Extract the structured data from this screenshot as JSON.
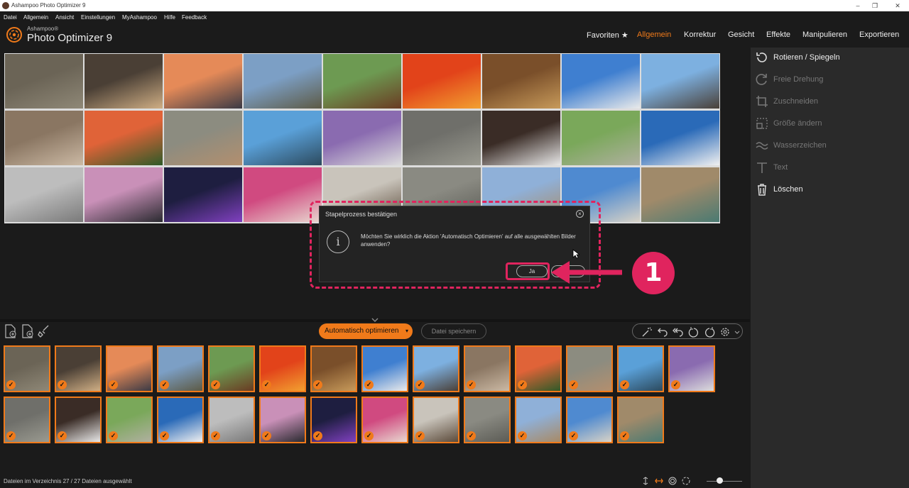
{
  "window": {
    "title": "Ashampoo Photo Optimizer 9"
  },
  "menu": [
    "Datei",
    "Allgemein",
    "Ansicht",
    "Einstellungen",
    "MyAshampoo",
    "Hilfe",
    "Feedback"
  ],
  "logo": {
    "brand": "Ashampoo®",
    "product": "Photo Optimizer 9"
  },
  "nav": {
    "items": [
      "Favoriten ★",
      "Allgemein",
      "Korrektur",
      "Gesicht",
      "Effekte",
      "Manipulieren",
      "Exportieren"
    ],
    "active": "Allgemein"
  },
  "sidebar": {
    "items": [
      {
        "label": "Rotieren / Spiegeln",
        "icon": "rotate-flip-icon",
        "enabled": true
      },
      {
        "label": "Freie Drehung",
        "icon": "free-rotate-icon",
        "enabled": false
      },
      {
        "label": "Zuschneiden",
        "icon": "crop-icon",
        "enabled": false
      },
      {
        "label": "Größe ändern",
        "icon": "resize-icon",
        "enabled": false
      },
      {
        "label": "Wasserzeichen",
        "icon": "watermark-icon",
        "enabled": false
      },
      {
        "label": "Text",
        "icon": "text-icon",
        "enabled": false
      },
      {
        "label": "Löschen",
        "icon": "trash-icon",
        "enabled": true
      }
    ]
  },
  "dialog": {
    "title": "Stapelprozess bestätigen",
    "message": "Möchten Sie wirklich die Aktion 'Automatisch Optimieren' auf alle ausgewählten Bilder anwenden?",
    "yes_label": "Ja",
    "step_number": "1"
  },
  "bottom": {
    "optimize_label": "Automatisch optimieren",
    "save_label": "Datei speichern"
  },
  "status": {
    "text": "Dateien im Verzeichnis 27 / 27 Dateien ausgewählt"
  },
  "colors": {
    "accent": "#f07a1a",
    "annotation": "#e0245e"
  },
  "photos": [
    {
      "name": "temple-ruins",
      "c1": "#6b6456",
      "c2": "#8f8877"
    },
    {
      "name": "cat",
      "c1": "#4a3f35",
      "c2": "#cfae84"
    },
    {
      "name": "sunset-boat",
      "c1": "#e58a58",
      "c2": "#3b3a45"
    },
    {
      "name": "tree-lake",
      "c1": "#7c9fc5",
      "c2": "#5d5a45"
    },
    {
      "name": "horse-fence",
      "c1": "#6d9a52",
      "c2": "#6a3b22"
    },
    {
      "name": "orange-flower",
      "c1": "#e2431a",
      "c2": "#f2a030"
    },
    {
      "name": "pastries",
      "c1": "#7a4f2a",
      "c2": "#c79a5a"
    },
    {
      "name": "heron-roof",
      "c1": "#3f7fd0",
      "c2": "#eaeaea"
    },
    {
      "name": "old-houses",
      "c1": "#7db0e0",
      "c2": "#4a4038"
    },
    {
      "name": "sepia-houses",
      "c1": "#8a7662",
      "c2": "#cbb9a4"
    },
    {
      "name": "red-flowers",
      "c1": "#e06338",
      "c2": "#2f5a28"
    },
    {
      "name": "marmot",
      "c1": "#8c8c80",
      "c2": "#b38f6e"
    },
    {
      "name": "hallstatt-lake",
      "c1": "#5aa0d8",
      "c2": "#2c4a5e"
    },
    {
      "name": "violets-village",
      "c1": "#8a6bb0",
      "c2": "#dcdcdc"
    },
    {
      "name": "monkeys",
      "c1": "#6f6f6a",
      "c2": "#9a9a90"
    },
    {
      "name": "horses-street",
      "c1": "#3a2c26",
      "c2": "#e8e8e8"
    },
    {
      "name": "park-bench",
      "c1": "#7aa85a",
      "c2": "#b0b0a0"
    },
    {
      "name": "santorini-dome",
      "c1": "#2a6ab8",
      "c2": "#f0f0f0"
    },
    {
      "name": "colonial-building",
      "c1": "#bdbdbd",
      "c2": "#7a7a7a"
    },
    {
      "name": "palms-sunset",
      "c1": "#c990b8",
      "c2": "#2a2a30"
    },
    {
      "name": "towers-night",
      "c1": "#1e1e40",
      "c2": "#8040c0"
    },
    {
      "name": "pink-window",
      "c1": "#d04a80",
      "c2": "#e8d8d0"
    },
    {
      "name": "beach-dogs",
      "c1": "#c9c4bb",
      "c2": "#5b4a3a"
    },
    {
      "name": "stone-face",
      "c1": "#8a8a82",
      "c2": "#5b5b55"
    },
    {
      "name": "old-street",
      "c1": "#8fb0d8",
      "c2": "#a88a66"
    },
    {
      "name": "harbour-view",
      "c1": "#4f8ad0",
      "c2": "#d8d2c6"
    },
    {
      "name": "venice-canal",
      "c1": "#a08a6a",
      "c2": "#4a7a72"
    }
  ]
}
